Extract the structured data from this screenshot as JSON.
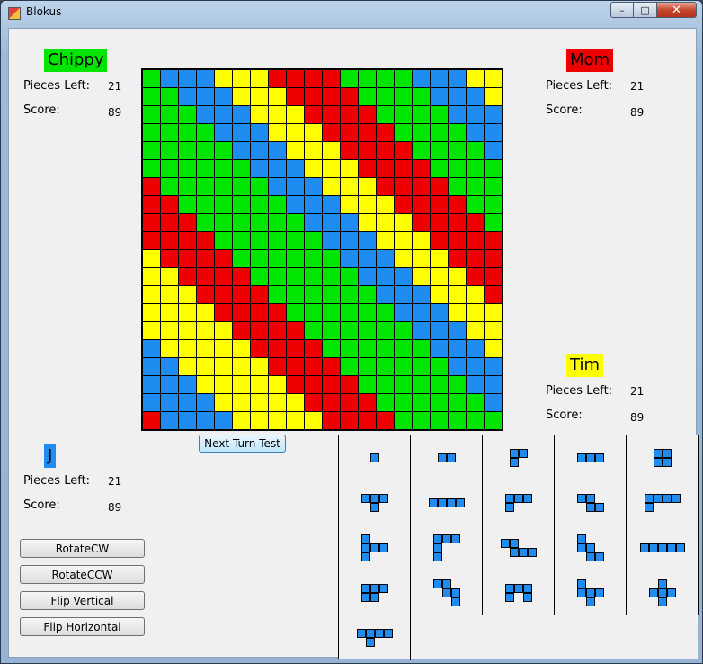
{
  "window": {
    "title": "Blokus",
    "controls": {
      "minimize": "–",
      "maximize": "□",
      "close": "✕"
    }
  },
  "colors": {
    "G": "#00e600",
    "B": "#1e8cf0",
    "Y": "#ffff00",
    "R": "#ee0000"
  },
  "players": [
    {
      "id": "chippy",
      "name": "Chippy",
      "color": "#00e600",
      "pieces_left_label": "Pieces Left:",
      "pieces_left": "21",
      "score_label": "Score:",
      "score": "89"
    },
    {
      "id": "mom",
      "name": "Mom",
      "color": "#ee0000",
      "pieces_left_label": "Pieces Left:",
      "pieces_left": "21",
      "score_label": "Score:",
      "score": "89"
    },
    {
      "id": "tim",
      "name": "Tim",
      "color": "#ffff00",
      "pieces_left_label": "Pieces Left:",
      "pieces_left": "21",
      "score_label": "Score:",
      "score": "89"
    },
    {
      "id": "j",
      "name": "J",
      "color": "#1e8cf0",
      "pieces_left_label": "Pieces Left:",
      "pieces_left": "21",
      "score_label": "Score:",
      "score": "89"
    }
  ],
  "board": {
    "rows": [
      "GBBBYYYRRRRGGGGBBBYY",
      "GGBBBYYYRRRRGGGGBBBY",
      "GGGBBBYYYRRRRGGGGBBB",
      "GGGGBBBYYYRRRRGGGGBB",
      "GGGGGBBBYYYRRRRGGGGB",
      "GGGGGGBBBYYYRRRRGGGG",
      "RGGGGGGBBBYYYRRRRGGG",
      "RRGGGGGGBBBYYYRRRRGG",
      "RRRGGGGGGBBBYYYRRRRG",
      "RRRRGGGGGGBBBYYYRRRR",
      "YRRRRGGGGGGBBBYYYRRR",
      "YYRRRRGGGGGGBBBYYYRR",
      "YYYRRRRGGGGGGBBBYYYR",
      "YYYYRRRRGGGGGGBBBYYY",
      "YYYYYRRRRGGGGGGBBBYY",
      "BYYYYYRRRRGGGGGGBBBY",
      "BBYYYYYRRRRGGGGGGBBB",
      "BBBYYYYYRRRRGGGGGGBB",
      "BBBBYYYYYRRRRGGGGGGB",
      "RBBBBYYYYYRRRRGGGGGG"
    ]
  },
  "buttons": {
    "next_turn": "Next Turn Test",
    "rotate_cw": "RotateCW",
    "rotate_ccw": "RotateCCW",
    "flip_vertical": "Flip Vertical",
    "flip_horizontal": "Flip Horizontal"
  },
  "pieces": [
    {
      "cells": [
        [
          0,
          0
        ]
      ]
    },
    {
      "cells": [
        [
          0,
          0
        ],
        [
          1,
          0
        ]
      ]
    },
    {
      "cells": [
        [
          0,
          0
        ],
        [
          1,
          0
        ],
        [
          0,
          1
        ]
      ]
    },
    {
      "cells": [
        [
          0,
          0
        ],
        [
          1,
          0
        ],
        [
          2,
          0
        ]
      ]
    },
    {
      "cells": [
        [
          0,
          0
        ],
        [
          1,
          0
        ],
        [
          0,
          1
        ],
        [
          1,
          1
        ]
      ]
    },
    {
      "cells": [
        [
          0,
          0
        ],
        [
          1,
          0
        ],
        [
          2,
          0
        ],
        [
          1,
          1
        ]
      ]
    },
    {
      "cells": [
        [
          0,
          0
        ],
        [
          1,
          0
        ],
        [
          2,
          0
        ],
        [
          3,
          0
        ]
      ]
    },
    {
      "cells": [
        [
          0,
          0
        ],
        [
          1,
          0
        ],
        [
          2,
          0
        ],
        [
          0,
          1
        ]
      ]
    },
    {
      "cells": [
        [
          0,
          0
        ],
        [
          1,
          0
        ],
        [
          1,
          1
        ],
        [
          2,
          1
        ]
      ]
    },
    {
      "cells": [
        [
          0,
          0
        ],
        [
          1,
          0
        ],
        [
          2,
          0
        ],
        [
          3,
          0
        ],
        [
          0,
          1
        ]
      ]
    },
    {
      "cells": [
        [
          0,
          0
        ],
        [
          0,
          1
        ],
        [
          1,
          1
        ],
        [
          2,
          1
        ],
        [
          0,
          2
        ]
      ]
    },
    {
      "cells": [
        [
          0,
          0
        ],
        [
          1,
          0
        ],
        [
          2,
          0
        ],
        [
          0,
          1
        ],
        [
          0,
          2
        ]
      ]
    },
    {
      "cells": [
        [
          0,
          0
        ],
        [
          1,
          0
        ],
        [
          1,
          1
        ],
        [
          2,
          1
        ],
        [
          3,
          1
        ]
      ]
    },
    {
      "cells": [
        [
          0,
          0
        ],
        [
          0,
          1
        ],
        [
          1,
          1
        ],
        [
          1,
          2
        ],
        [
          2,
          2
        ]
      ]
    },
    {
      "cells": [
        [
          0,
          0
        ],
        [
          1,
          0
        ],
        [
          2,
          0
        ],
        [
          3,
          0
        ],
        [
          4,
          0
        ]
      ]
    },
    {
      "cells": [
        [
          0,
          0
        ],
        [
          1,
          0
        ],
        [
          2,
          0
        ],
        [
          0,
          1
        ],
        [
          1,
          1
        ]
      ]
    },
    {
      "cells": [
        [
          0,
          0
        ],
        [
          1,
          0
        ],
        [
          1,
          1
        ],
        [
          2,
          1
        ],
        [
          2,
          2
        ]
      ]
    },
    {
      "cells": [
        [
          0,
          0
        ],
        [
          1,
          0
        ],
        [
          2,
          0
        ],
        [
          0,
          1
        ],
        [
          2,
          1
        ]
      ]
    },
    {
      "cells": [
        [
          0,
          0
        ],
        [
          0,
          1
        ],
        [
          1,
          1
        ],
        [
          2,
          1
        ],
        [
          1,
          2
        ]
      ]
    },
    {
      "cells": [
        [
          1,
          0
        ],
        [
          0,
          1
        ],
        [
          1,
          1
        ],
        [
          2,
          1
        ],
        [
          1,
          2
        ]
      ]
    },
    {
      "cells": [
        [
          0,
          0
        ],
        [
          1,
          0
        ],
        [
          2,
          0
        ],
        [
          3,
          0
        ],
        [
          1,
          1
        ]
      ]
    }
  ]
}
